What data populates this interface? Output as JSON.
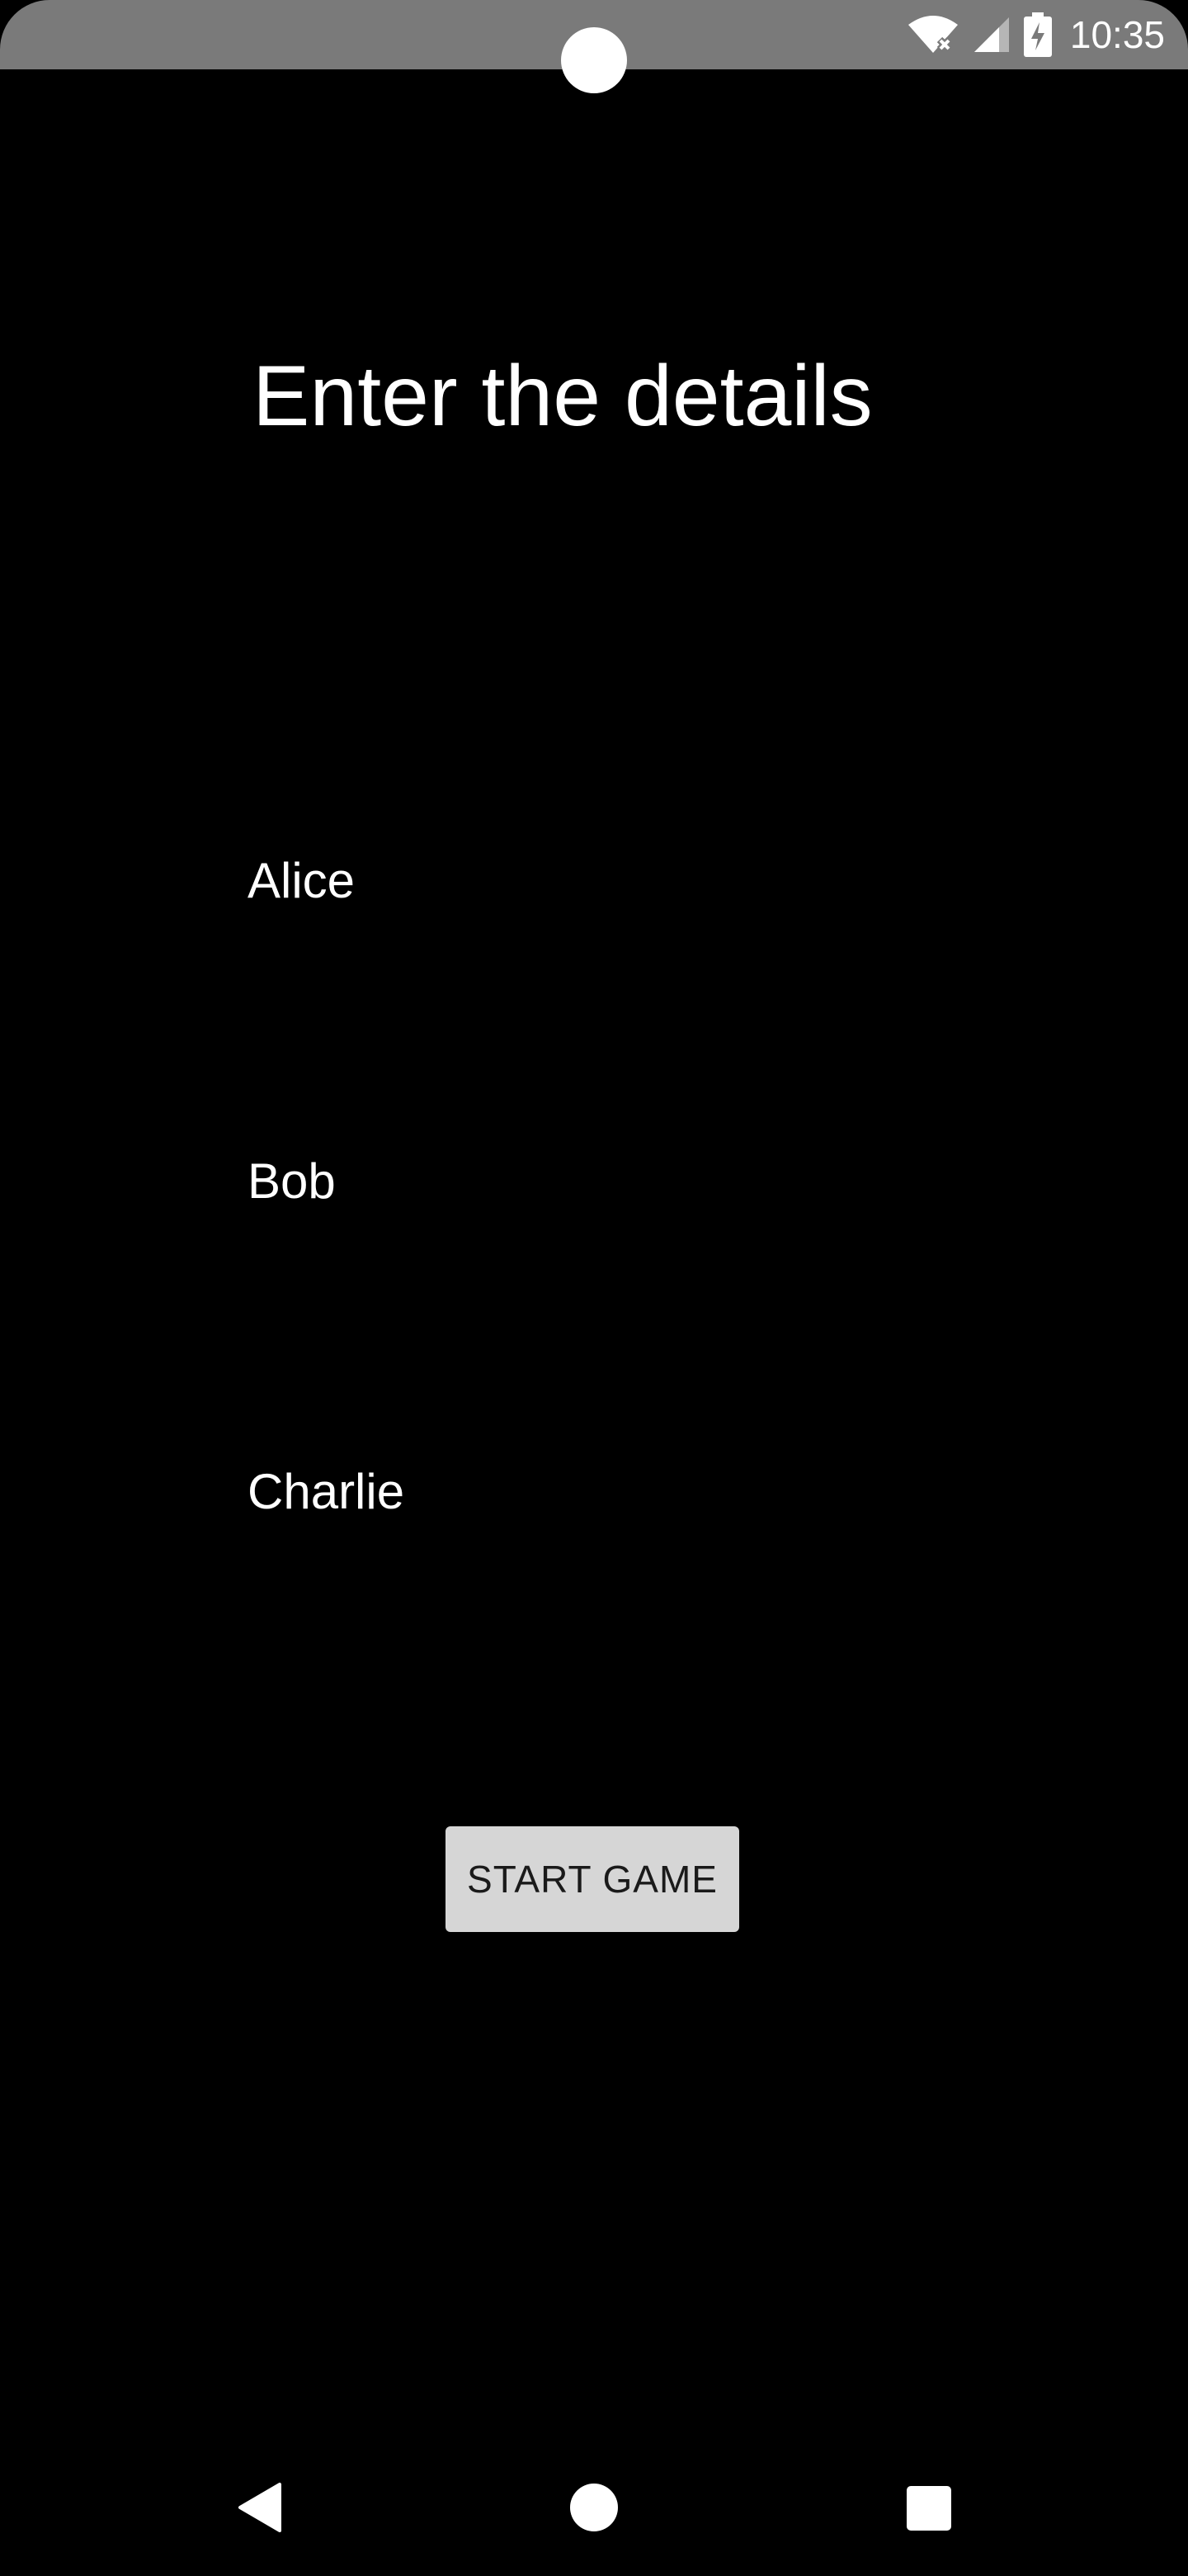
{
  "status_bar": {
    "time": "10:35",
    "icons": [
      "wifi-off-icon",
      "cell-signal-icon",
      "battery-charging-icon"
    ]
  },
  "screen": {
    "title": "Enter the details",
    "players": [
      "Alice",
      "Bob",
      "Charlie"
    ],
    "start_button_label": "START GAME"
  },
  "nav_bar": {
    "icons": [
      "back-icon",
      "home-icon",
      "recents-icon"
    ]
  },
  "colors": {
    "background": "#000000",
    "status_bar": "#7a7a7a",
    "text": "#ffffff",
    "button": "#d6d6d6"
  }
}
